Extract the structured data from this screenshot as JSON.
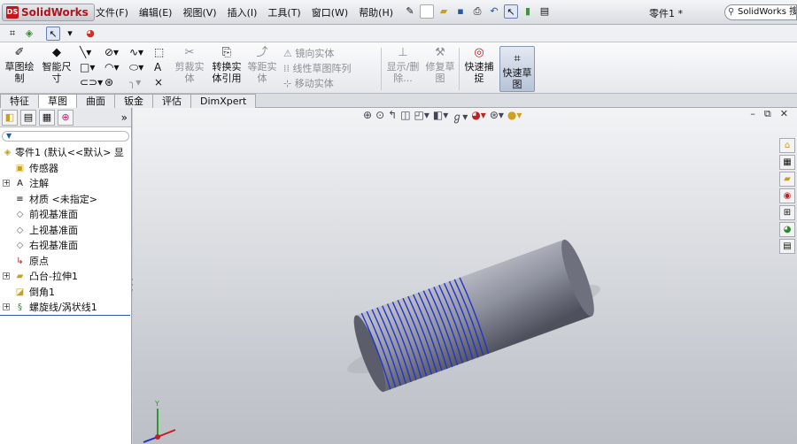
{
  "app": {
    "logo": "SolidWorks",
    "menus": [
      "文件(F)",
      "编辑(E)",
      "视图(V)",
      "插入(I)",
      "工具(T)",
      "窗口(W)",
      "帮助(H)"
    ],
    "doc_title": "零件1 *",
    "search_placeholder": "SolidWorks 搜索"
  },
  "command_manager": {
    "sketch": "草图绘制",
    "smart_dim": "智能尺寸",
    "trim": "剪裁实体",
    "convert": "转换实体引用",
    "offset": "等距实体",
    "mirror": "镜向实体",
    "linear_pattern": "线性草图阵列",
    "move": "移动实体",
    "display_delete": "显示/删除...",
    "repair": "修复草图",
    "quick_snap": "快速捕捉",
    "rapid_sketch": "快速草图"
  },
  "tabs": [
    "特征",
    "草图",
    "曲面",
    "钣金",
    "评估",
    "DimXpert"
  ],
  "tree": {
    "root": "零件1 (默认<<默认> 显",
    "items": [
      {
        "label": "传感器",
        "expand": false
      },
      {
        "label": "注解",
        "expand": true
      },
      {
        "label": "材质 <未指定>",
        "expand": false
      },
      {
        "label": "前视基准面",
        "expand": false
      },
      {
        "label": "上视基准面",
        "expand": false
      },
      {
        "label": "右视基准面",
        "expand": false
      },
      {
        "label": "原点",
        "expand": false
      },
      {
        "label": "凸台-拉伸1",
        "expand": true
      },
      {
        "label": "倒角1",
        "expand": false
      },
      {
        "label": "螺旋线/涡状线1",
        "expand": true
      }
    ]
  },
  "colors": {
    "thread": "#2233cc",
    "cylinder": "#8c8f9c",
    "background_top": "#f2f3f5",
    "background_bottom": "#c4c8ce"
  }
}
